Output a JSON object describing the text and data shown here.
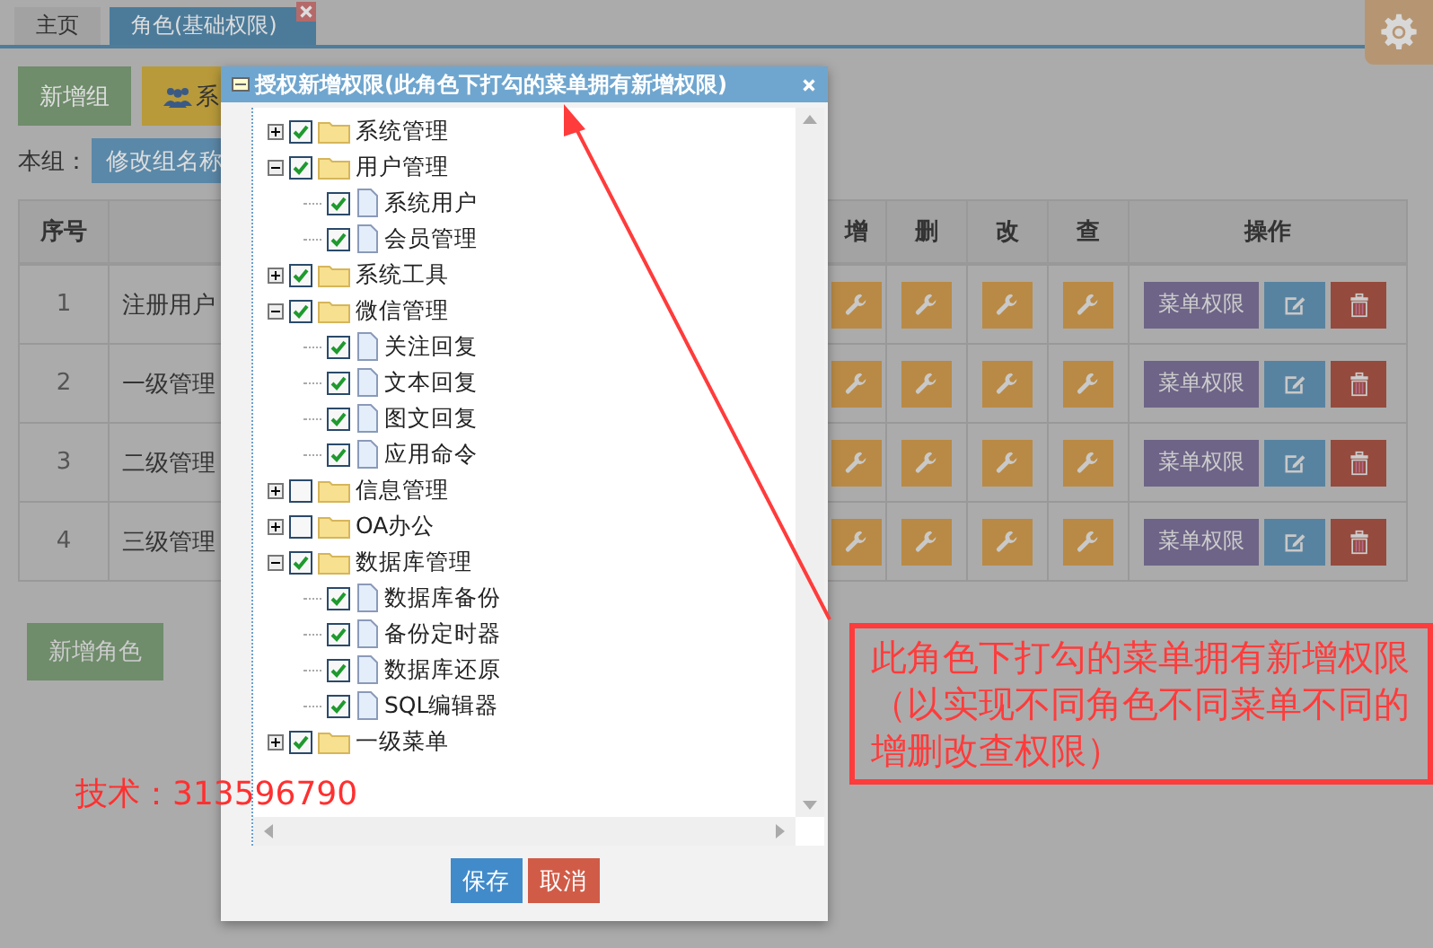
{
  "tabs": [
    {
      "label": "主页",
      "selected": false,
      "closable": false
    },
    {
      "label": "角色(基础权限)",
      "selected": true,
      "closable": true
    }
  ],
  "toolbar": {
    "buttons": [
      {
        "label": "新增组",
        "kind": "green"
      },
      {
        "label": "系",
        "kind": "yellow"
      }
    ]
  },
  "group_bar": {
    "label": "本组：",
    "button": "修改组名称"
  },
  "table": {
    "columns": [
      "序号",
      "增",
      "删",
      "改",
      "查",
      "操作"
    ],
    "rows": [
      {
        "index": "1",
        "name": "注册用户",
        "action": "菜单权限"
      },
      {
        "index": "2",
        "name": "一级管理",
        "action": "菜单权限"
      },
      {
        "index": "3",
        "name": "二级管理",
        "action": "菜单权限"
      },
      {
        "index": "4",
        "name": "三级管理",
        "action": "菜单权限"
      }
    ]
  },
  "add_role_button": "新增角色",
  "contact": "技术：313596790",
  "dialog": {
    "title": "授权新增权限(此角色下打勾的菜单拥有新增权限)",
    "tree": [
      {
        "label": "系统管理",
        "kind": "folder",
        "checked": true,
        "expanded": false
      },
      {
        "label": "用户管理",
        "kind": "folder",
        "checked": true,
        "expanded": true,
        "children": [
          {
            "label": "系统用户",
            "kind": "file",
            "checked": true
          },
          {
            "label": "会员管理",
            "kind": "file",
            "checked": true
          }
        ]
      },
      {
        "label": "系统工具",
        "kind": "folder",
        "checked": true,
        "expanded": false
      },
      {
        "label": "微信管理",
        "kind": "folder",
        "checked": true,
        "expanded": true,
        "children": [
          {
            "label": "关注回复",
            "kind": "file",
            "checked": true
          },
          {
            "label": "文本回复",
            "kind": "file",
            "checked": true
          },
          {
            "label": "图文回复",
            "kind": "file",
            "checked": true
          },
          {
            "label": "应用命令",
            "kind": "file",
            "checked": true
          }
        ]
      },
      {
        "label": "信息管理",
        "kind": "folder",
        "checked": false,
        "expanded": false
      },
      {
        "label": "OA办公",
        "kind": "folder",
        "checked": false,
        "expanded": false
      },
      {
        "label": "数据库管理",
        "kind": "folder",
        "checked": true,
        "expanded": true,
        "children": [
          {
            "label": "数据库备份",
            "kind": "file",
            "checked": true
          },
          {
            "label": "备份定时器",
            "kind": "file",
            "checked": true
          },
          {
            "label": "数据库还原",
            "kind": "file",
            "checked": true
          },
          {
            "label": "SQL编辑器",
            "kind": "file",
            "checked": true
          }
        ]
      },
      {
        "label": "一级菜单",
        "kind": "folder",
        "checked": true,
        "expanded": false
      }
    ],
    "buttons": [
      {
        "label": "保存",
        "kind": "primary"
      },
      {
        "label": "取消",
        "kind": "danger"
      }
    ]
  },
  "annotation": {
    "text": "此角色下打勾的菜单拥有新增权限（以实现不同角色不同菜单不同的增删改查权限）"
  }
}
